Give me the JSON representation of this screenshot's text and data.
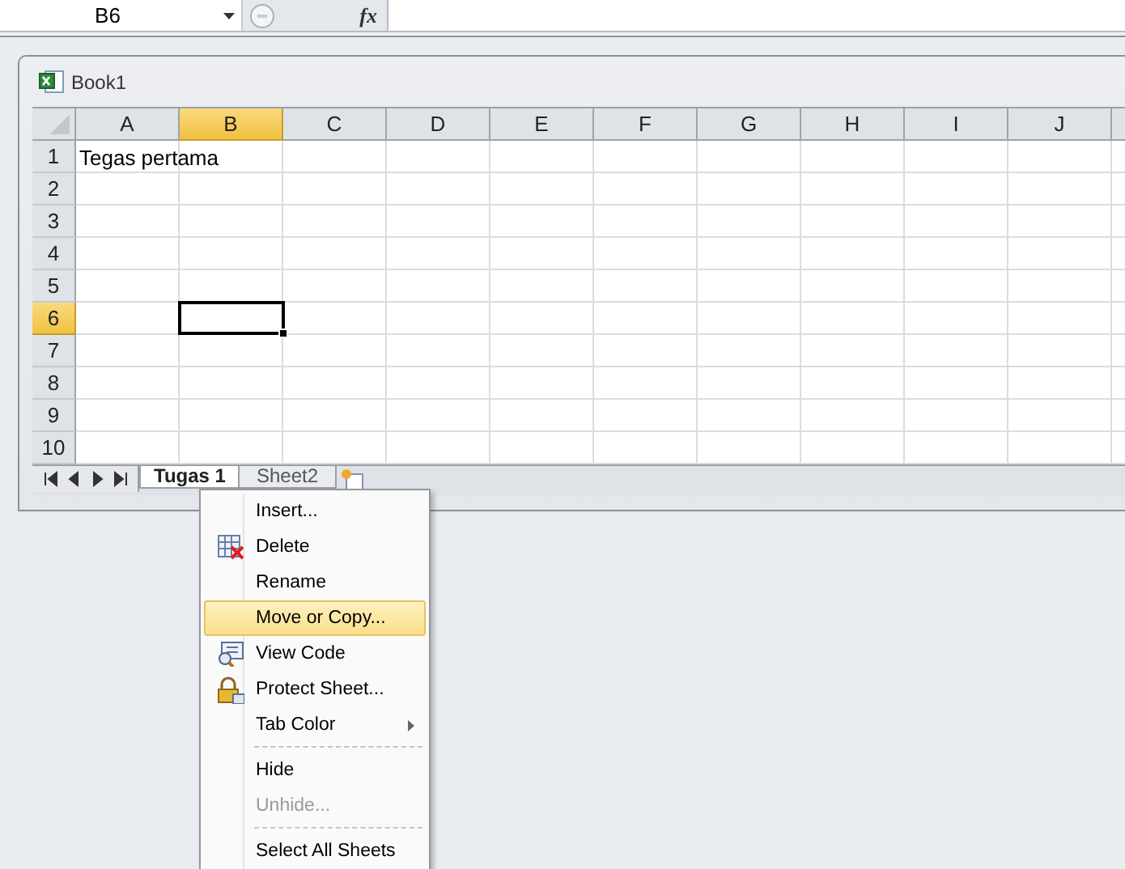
{
  "formula_bar": {
    "name_box": "B6",
    "function_label": "fx"
  },
  "workbook": {
    "title": "Book1",
    "columns": [
      {
        "label": "A",
        "selected": false
      },
      {
        "label": "B",
        "selected": true
      },
      {
        "label": "C",
        "selected": false
      },
      {
        "label": "D",
        "selected": false
      },
      {
        "label": "E",
        "selected": false
      },
      {
        "label": "F",
        "selected": false
      },
      {
        "label": "G",
        "selected": false
      },
      {
        "label": "H",
        "selected": false
      },
      {
        "label": "I",
        "selected": false
      },
      {
        "label": "J",
        "selected": false
      }
    ],
    "rows": [
      {
        "label": "1",
        "selected": false,
        "cells": [
          "Tegas pertama"
        ]
      },
      {
        "label": "2",
        "selected": false
      },
      {
        "label": "3",
        "selected": false
      },
      {
        "label": "4",
        "selected": false
      },
      {
        "label": "5",
        "selected": false
      },
      {
        "label": "6",
        "selected": true
      },
      {
        "label": "7",
        "selected": false
      },
      {
        "label": "8",
        "selected": false
      },
      {
        "label": "9",
        "selected": false
      },
      {
        "label": "10",
        "selected": false
      }
    ],
    "sheet_tabs": [
      {
        "label": "Tugas 1",
        "selected": true
      },
      {
        "label": "Sheet2",
        "selected": false
      }
    ]
  },
  "context_menu": [
    {
      "kind": "plain",
      "label": "Insert...",
      "selected": false,
      "disabled": false,
      "has_submenu": false
    },
    {
      "kind": "delete",
      "label": "Delete",
      "selected": false,
      "disabled": false,
      "has_submenu": false
    },
    {
      "kind": "plain",
      "label": "Rename",
      "selected": false,
      "disabled": false,
      "has_submenu": false
    },
    {
      "kind": "plain",
      "label": "Move or Copy...",
      "selected": true,
      "disabled": false,
      "has_submenu": false
    },
    {
      "kind": "code",
      "label": "View Code",
      "selected": false,
      "disabled": false,
      "has_submenu": false
    },
    {
      "kind": "lock",
      "label": "Protect Sheet...",
      "selected": false,
      "disabled": false,
      "has_submenu": false
    },
    {
      "kind": "plain",
      "label": "Tab Color",
      "selected": false,
      "disabled": false,
      "has_submenu": true
    },
    {
      "kind": "separator"
    },
    {
      "kind": "plain",
      "label": "Hide",
      "selected": false,
      "disabled": false,
      "has_submenu": false
    },
    {
      "kind": "plain",
      "label": "Unhide...",
      "selected": false,
      "disabled": true,
      "has_submenu": false
    },
    {
      "kind": "separator"
    },
    {
      "kind": "plain",
      "label": "Select All Sheets",
      "selected": false,
      "disabled": false,
      "has_submenu": false
    }
  ]
}
